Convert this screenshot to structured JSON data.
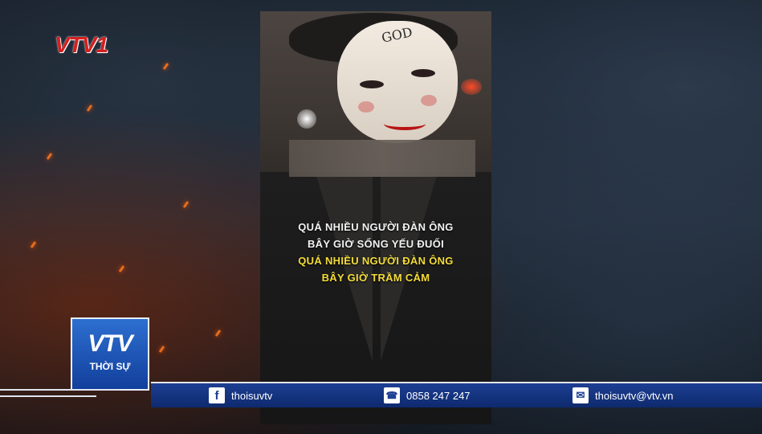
{
  "channel_logo": "VTV1",
  "video": {
    "mask_text": "GOD",
    "lyrics": [
      {
        "text": "QUÁ NHIỀU NGƯỜI ĐÀN ÔNG",
        "color": "#f2f2f2"
      },
      {
        "text": "BÂY GIỜ SỐNG YẾU ĐUỐI",
        "color": "#f2f2f2"
      },
      {
        "text": "QUÁ NHIỀU NGƯỜI ĐÀN ÔNG",
        "color": "#f4dc3a"
      },
      {
        "text": "BÂY GIỜ TRẦM CẢM",
        "color": "#f4dc3a"
      }
    ]
  },
  "program_badge": {
    "logo": "VTV",
    "subtitle": "THỜI SỰ"
  },
  "ticker": {
    "facebook_icon": "facebook-icon",
    "facebook": "thoisuvtv",
    "phone_icon": "phone-icon",
    "phone": "0858 247 247",
    "email_icon": "mail-icon",
    "email": "thoisuvtv@vtv.vn"
  },
  "colors": {
    "ticker_bg": "#1d3f93",
    "accent_red": "#d61f1f",
    "lyric_yellow": "#f4dc3a"
  }
}
